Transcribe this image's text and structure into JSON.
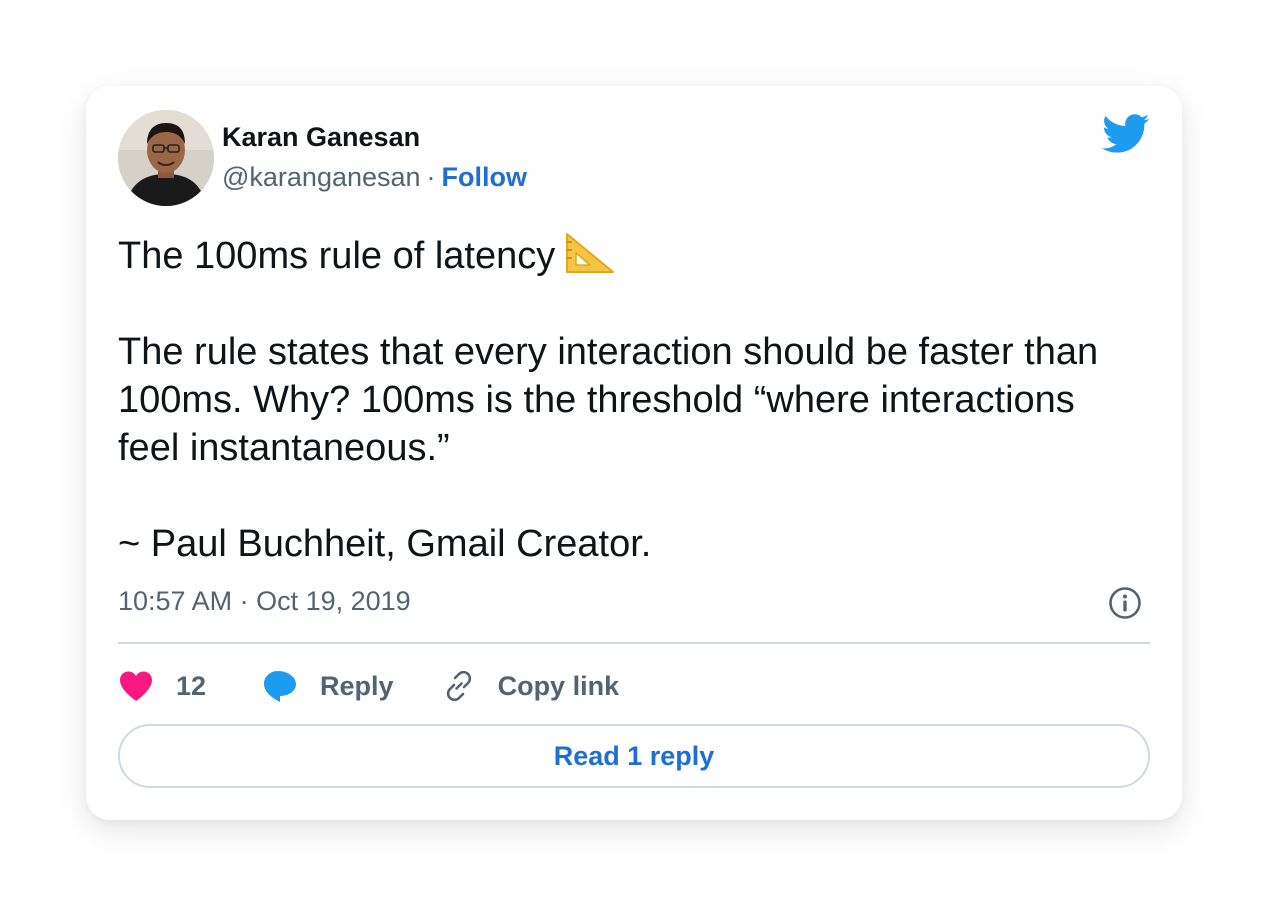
{
  "author": {
    "name": "Karan Ganesan",
    "handle": "@karanganesan",
    "separator": "·",
    "follow_label": "Follow"
  },
  "tweet": {
    "line1": "The 100ms rule of latency",
    "line1_emoji": "triangular-ruler-icon",
    "para2": [
      "The rule states that every interaction should be faster than",
      "100ms. Why? 100ms is the threshold “where interactions",
      "feel instantaneous.”"
    ],
    "quote_attribution": "~ Paul Buchheit, Gmail Creator.",
    "timestamp": "10:57 AM · Oct 19, 2019"
  },
  "actions": {
    "like_count": "12",
    "reply_label": "Reply",
    "copy_link_label": "Copy link",
    "read_replies_label": "Read 1 reply"
  },
  "icons": {
    "platform": "twitter-bird-icon",
    "like": "heart-icon",
    "reply": "speech-bubble-icon",
    "copy": "link-icon",
    "info": "info-icon"
  },
  "colors": {
    "brand_blue": "#1d9bf0",
    "link_blue": "#1d6fd6",
    "heart_pink": "#f91880",
    "muted_text": "#536471",
    "divider": "#cfd9de"
  }
}
